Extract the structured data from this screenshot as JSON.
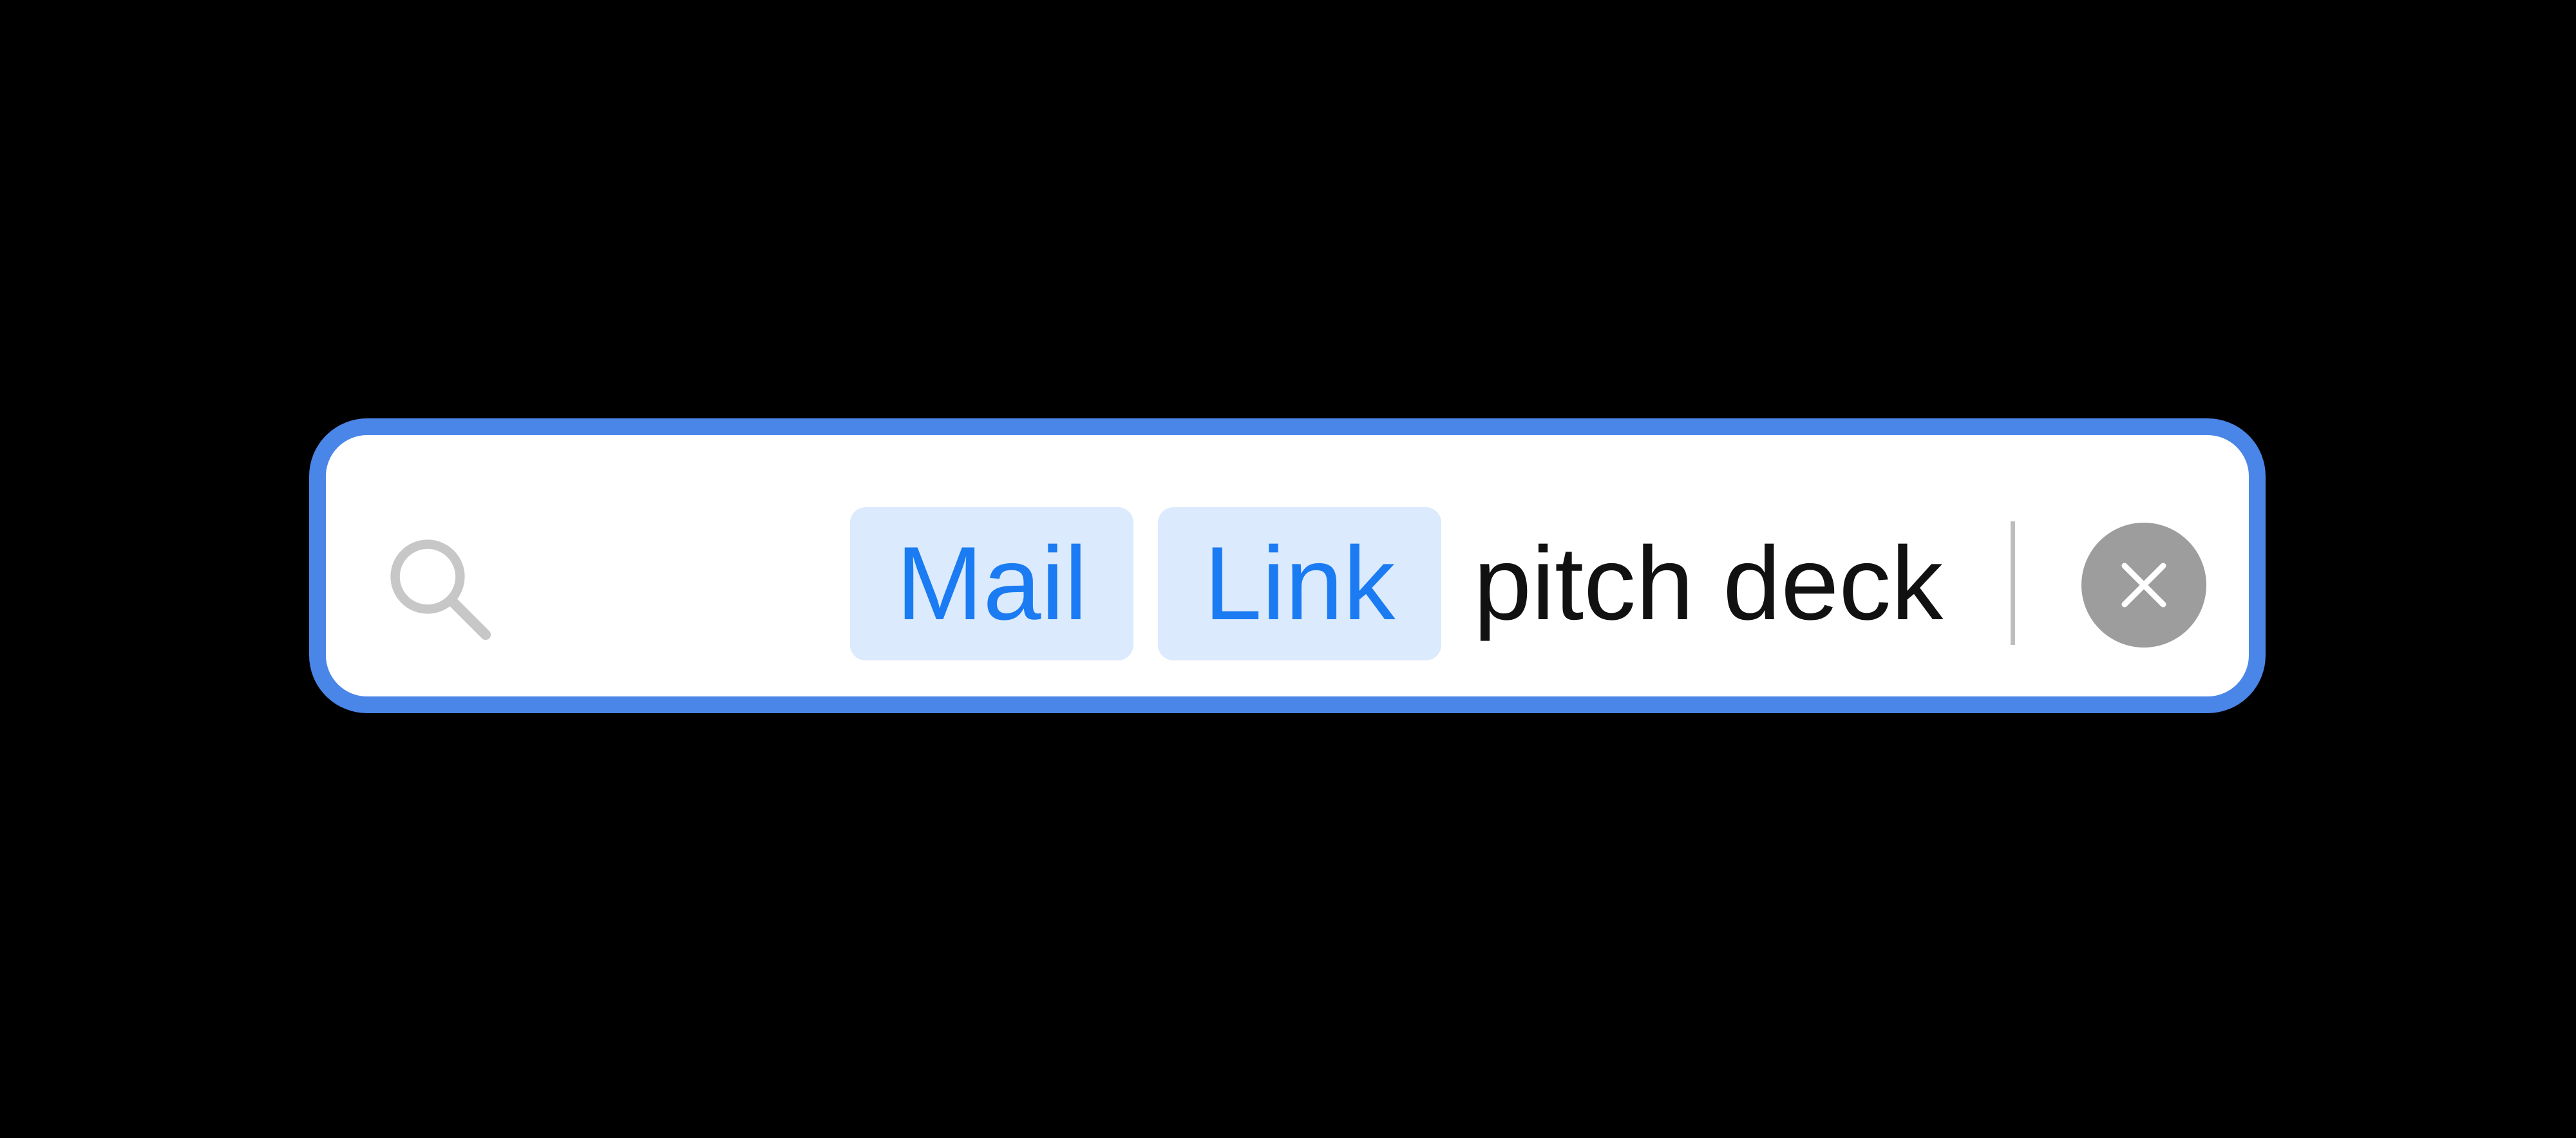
{
  "search": {
    "tokens": [
      {
        "label": "Mail"
      },
      {
        "label": "Link"
      }
    ],
    "query": "pitch deck",
    "icons": {
      "leading": "search-icon",
      "trailing": "clear-icon"
    },
    "colors": {
      "focus_ring": "#4a86e8",
      "token_background": "#dbeafd",
      "token_text": "#1a7bf2",
      "query_text": "#111111",
      "clear_button": "#9d9d9d"
    }
  }
}
